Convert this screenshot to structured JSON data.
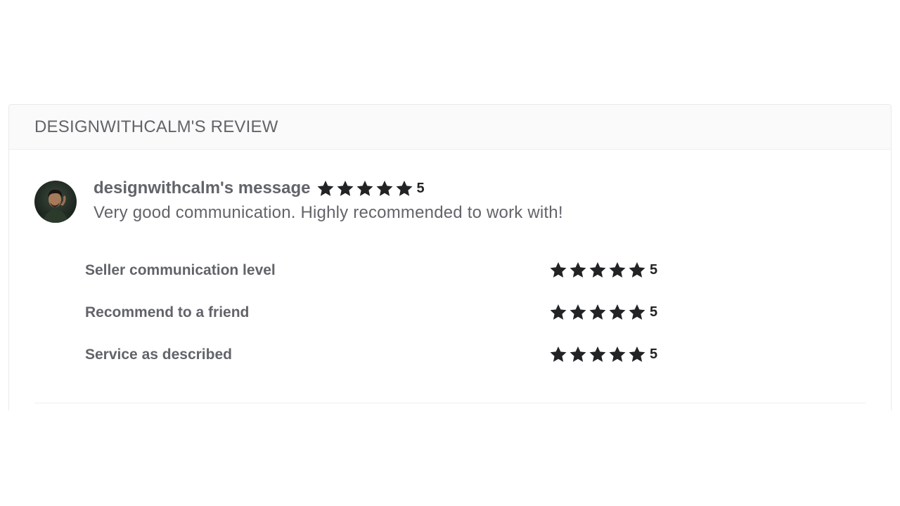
{
  "review": {
    "title": "DESIGNWITHCALM'S REVIEW",
    "reviewer_message_label": "designwithcalm's message",
    "overall_rating": "5",
    "overall_stars": 5,
    "text": "Very good communication. Highly recommended to work with!"
  },
  "breakdown": [
    {
      "label": "Seller communication level",
      "rating": "5",
      "stars": 5
    },
    {
      "label": "Recommend to a friend",
      "rating": "5",
      "stars": 5
    },
    {
      "label": "Service as described",
      "rating": "5",
      "stars": 5
    }
  ],
  "colors": {
    "star": "#222325",
    "text": "#62646a",
    "header_bg": "#fafafa"
  },
  "icons": {
    "star": "star-icon",
    "avatar": "avatar"
  }
}
